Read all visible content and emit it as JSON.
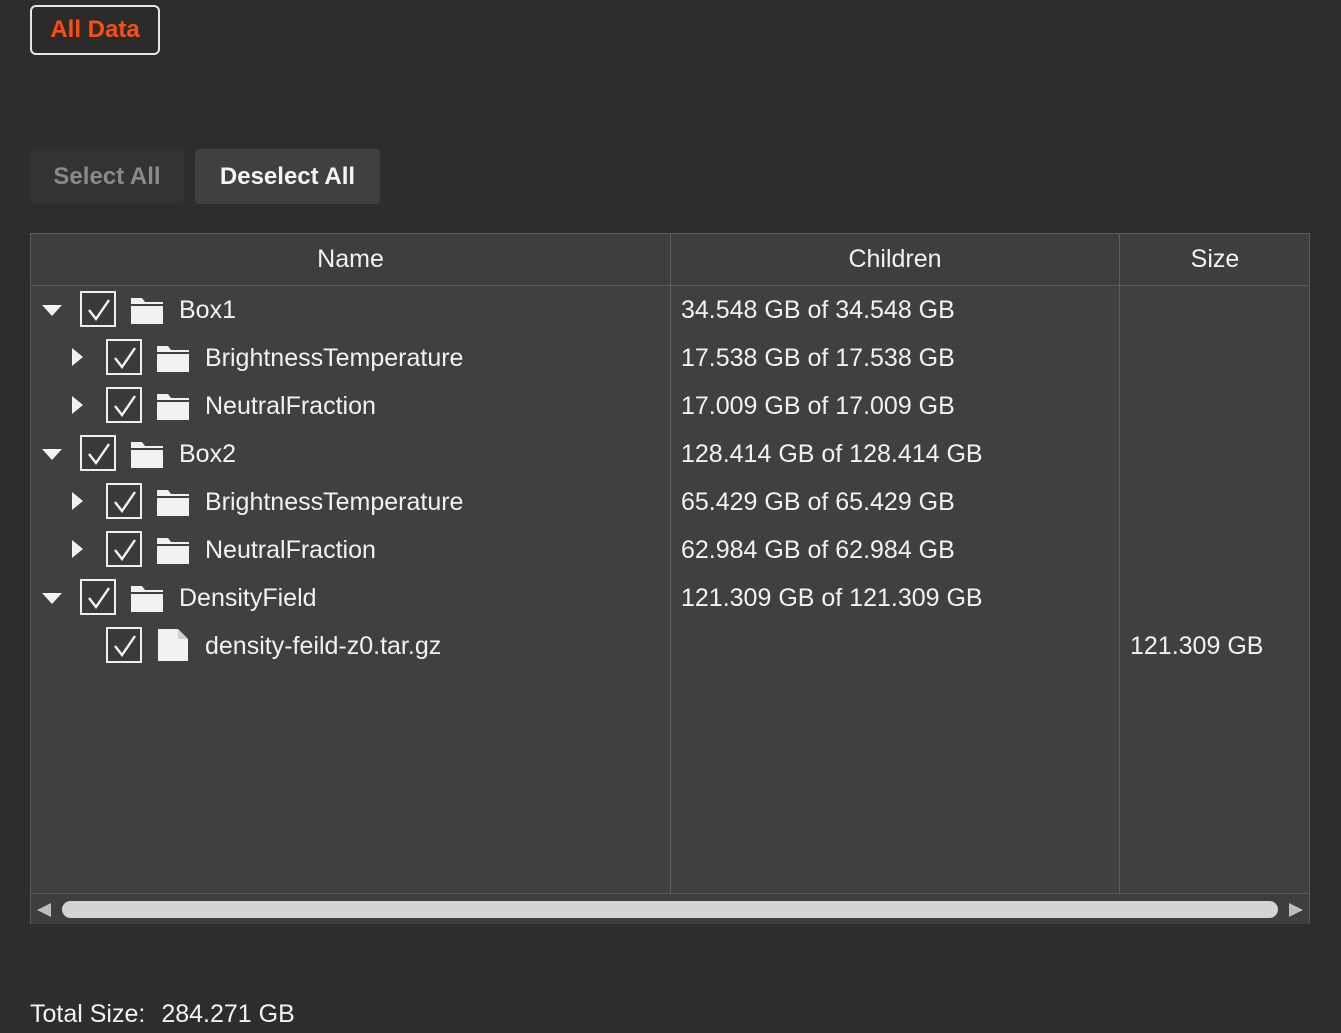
{
  "top": {
    "all_data_label": "All Data",
    "accent": "#ff4d0d"
  },
  "toolbar": {
    "select_all": "Select All",
    "deselect_all": "Deselect All"
  },
  "table": {
    "columns": [
      "Name",
      "Children",
      "Size"
    ],
    "rows": [
      {
        "name": "Box1",
        "children": "34.548 GB of 34.548 GB",
        "size": "",
        "icon": "folder-icon",
        "checked": true,
        "expanded": true
      },
      {
        "name": "BrightnessTemperature",
        "children": "17.538 GB of 17.538 GB",
        "size": "",
        "icon": "folder-icon",
        "checked": true,
        "expanded": false
      },
      {
        "name": "NeutralFraction",
        "children": "17.009 GB of 17.009 GB",
        "size": "",
        "icon": "folder-icon",
        "checked": true,
        "expanded": false
      },
      {
        "name": "Box2",
        "children": "128.414 GB of 128.414 GB",
        "size": "",
        "icon": "folder-icon",
        "checked": true,
        "expanded": true
      },
      {
        "name": "BrightnessTemperature",
        "children": "65.429 GB of 65.429 GB",
        "size": "",
        "icon": "folder-icon",
        "checked": true,
        "expanded": false
      },
      {
        "name": "NeutralFraction",
        "children": "62.984 GB of 62.984 GB",
        "size": "",
        "icon": "folder-icon",
        "checked": true,
        "expanded": false
      },
      {
        "name": "DensityField",
        "children": "121.309 GB of 121.309 GB",
        "size": "",
        "icon": "folder-icon",
        "checked": true,
        "expanded": true
      },
      {
        "name": "density-feild-z0.tar.gz",
        "children": "",
        "size": "121.309 GB",
        "icon": "file-icon",
        "checked": true
      }
    ]
  },
  "footer": {
    "total_label": "Total Size:",
    "total_value": "284.271 GB"
  }
}
